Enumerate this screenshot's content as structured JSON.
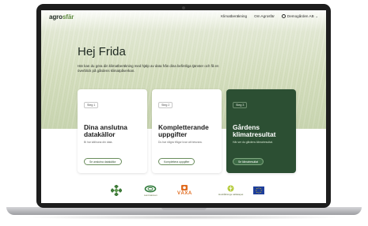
{
  "brand": {
    "logo_main": "agro",
    "logo_accent": "sfär"
  },
  "nav": {
    "items": [
      "Klimatberäkning",
      "Om Agrosfär"
    ],
    "user": "Demogården AB"
  },
  "hero": {
    "greeting": "Hej Frida",
    "text": "Här kan du göra din klimatberäkning med hjälp av data från dina befintliga tjänster och få en överblick på gårdens klimatpåverkan."
  },
  "cards": [
    {
      "step": "Steg 1",
      "title": "Dina anslutna datakällor",
      "sub": "Bi har källnuna din data.",
      "button": "Se anslutna datakällor",
      "dark": false
    },
    {
      "step": "Steg 2",
      "title": "Kompletterande uppgifter",
      "sub": "Du har några frågor kvar att besvara.",
      "button": "Komplettera uppgifter",
      "dark": false
    },
    {
      "step": "Steg 3",
      "title": "Gårdens klimatresultat",
      "sub": "Här ser du gårdens klimatresultat.",
      "button": "Se klimatresultat",
      "dark": true
    }
  ],
  "partners": [
    {
      "icon": "green-cross-logo-icon",
      "label": ""
    },
    {
      "icon": "lantmannen-logo-icon",
      "label": "Lantmännen"
    },
    {
      "icon": "vaxa-logo-icon",
      "label": "VÄXA"
    },
    {
      "icon": "hushallningssallskapet-logo-icon",
      "label": "Hushållnings sällskapet"
    },
    {
      "icon": "eu-flag-icon",
      "label": ""
    }
  ],
  "colors": {
    "accent_dark": "#2c4f33",
    "accent_green": "#5e8b3f",
    "vaxa_orange": "#e06b1f"
  }
}
